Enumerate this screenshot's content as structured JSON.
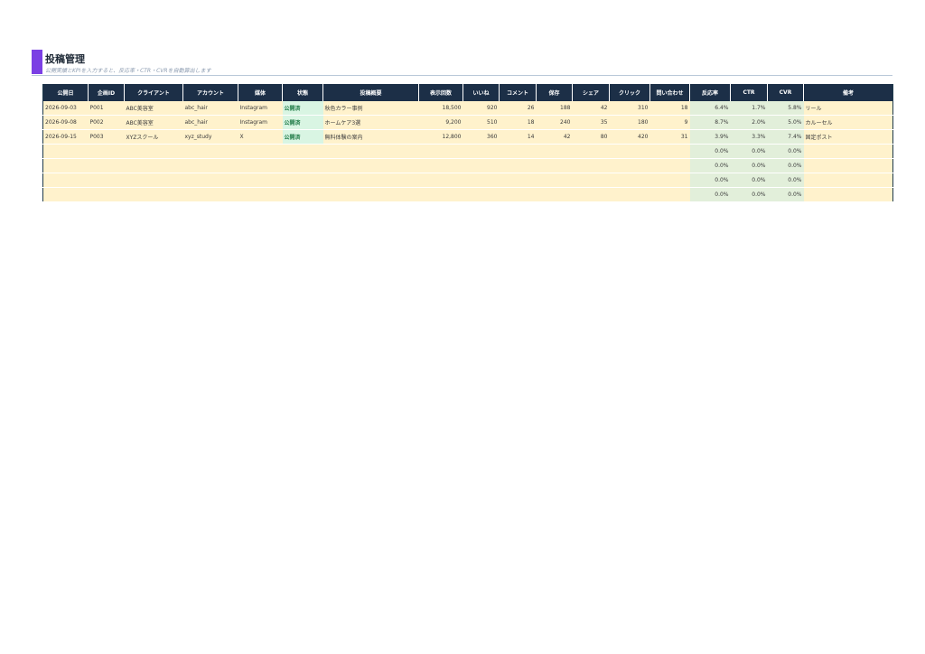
{
  "header": {
    "title": "投稿管理",
    "subtitle": "公開実績とKPIを入力すると、反応率・CTR・CVRを自動算出します"
  },
  "table": {
    "columns": [
      "公開日",
      "企画ID",
      "クライアント",
      "アカウント",
      "媒体",
      "状態",
      "投稿概要",
      "表示回数",
      "いいね",
      "コメント",
      "保存",
      "シェア",
      "クリック",
      "問い合わせ",
      "反応率",
      "CTR",
      "CVR",
      "備考"
    ],
    "rows": [
      [
        "2026-09-03",
        "P001",
        "ABC美容室",
        "abc_hair",
        "Instagram",
        "公開済",
        "秋色カラー事例",
        "18,500",
        "920",
        "26",
        "188",
        "42",
        "310",
        "18",
        "6.4%",
        "1.7%",
        "5.8%",
        "リール"
      ],
      [
        "2026-09-08",
        "P002",
        "ABC美容室",
        "abc_hair",
        "Instagram",
        "公開済",
        "ホームケア3選",
        "9,200",
        "510",
        "18",
        "240",
        "35",
        "180",
        "9",
        "8.7%",
        "2.0%",
        "5.0%",
        "カルーセル"
      ],
      [
        "2026-09-15",
        "P003",
        "XYZスクール",
        "xyz_study",
        "X",
        "公開済",
        "無料体験の案内",
        "12,800",
        "360",
        "14",
        "42",
        "80",
        "420",
        "31",
        "3.9%",
        "3.3%",
        "7.4%",
        "固定ポスト"
      ]
    ],
    "empty_rows": [
      [
        "0.0%",
        "0.0%",
        "0.0%"
      ],
      [
        "0.0%",
        "0.0%",
        "0.0%"
      ],
      [
        "0.0%",
        "0.0%",
        "0.0%"
      ],
      [
        "0.0%",
        "0.0%",
        "0.0%"
      ]
    ]
  },
  "colors": {
    "accent": "#7b3fe4",
    "header_bg": "#1c2f47",
    "row_bg": "#fff2cc",
    "kpi_bg": "#e2efda",
    "status_bg": "#d9f5e3",
    "status_text": "#1e7a46"
  }
}
